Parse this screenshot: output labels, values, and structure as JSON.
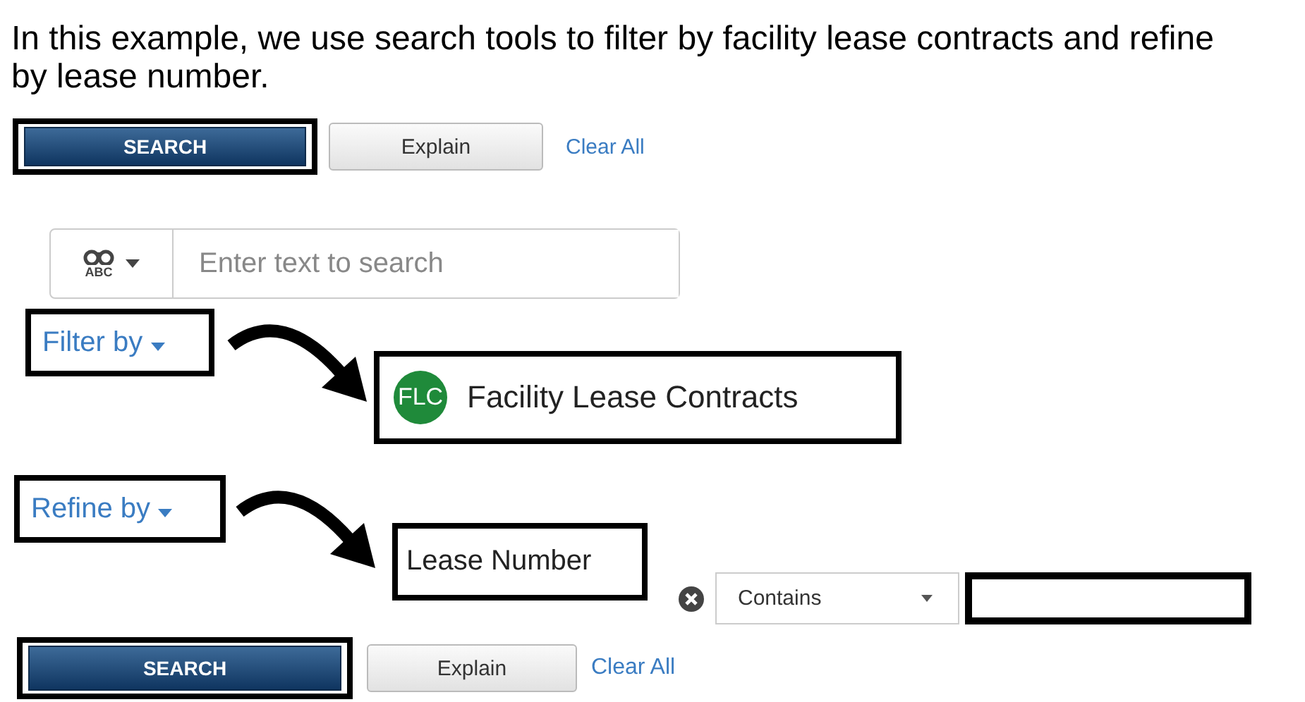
{
  "caption": "In this example, we use search tools to filter by facility lease contracts and refine by lease number.",
  "top_actions": {
    "search": "SEARCH",
    "explain": "Explain",
    "clear": "Clear All"
  },
  "search_field": {
    "icon_label": "ABC",
    "placeholder": "Enter text to search"
  },
  "filter": {
    "label": "Filter by",
    "badge": "FLC",
    "result": "Facility Lease Contracts"
  },
  "refine": {
    "label": "Refine by",
    "field": "Lease Number",
    "operator": "Contains"
  },
  "bottom_actions": {
    "search": "SEARCH",
    "explain": "Explain",
    "clear": "Clear All"
  }
}
